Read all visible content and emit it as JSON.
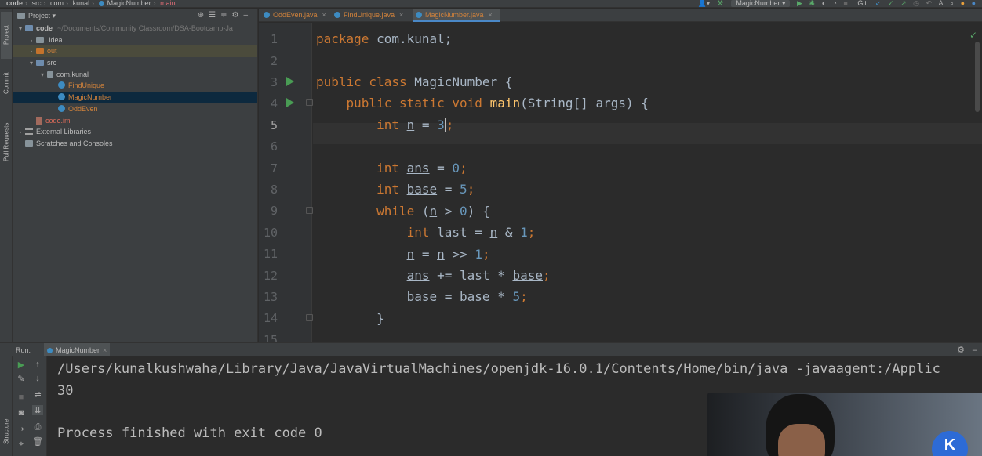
{
  "breadcrumbs": [
    "code",
    "src",
    "com",
    "kunal",
    "MagicNumber",
    "main"
  ],
  "toolbar": {
    "run_config": "MagicNumber",
    "git_label": "Git:"
  },
  "left_strip": {
    "tabs": [
      "Project",
      "Commit",
      "Pull Requests"
    ]
  },
  "project_panel": {
    "title": "Project",
    "tree": [
      {
        "label": "code",
        "detail": "~/Documents/Community Classroom/DSA-Bootcamp-Ja",
        "kind": "module"
      },
      {
        "label": ".idea",
        "kind": "folder"
      },
      {
        "label": "out",
        "kind": "out-folder"
      },
      {
        "label": "src",
        "kind": "src-folder"
      },
      {
        "label": "com.kunal",
        "kind": "package"
      },
      {
        "label": "FindUnique",
        "kind": "class"
      },
      {
        "label": "MagicNumber",
        "kind": "class",
        "selected": true
      },
      {
        "label": "OddEven",
        "kind": "class"
      },
      {
        "label": "code.iml",
        "kind": "iml"
      },
      {
        "label": "External Libraries",
        "kind": "libraries"
      },
      {
        "label": "Scratches and Consoles",
        "kind": "scratches"
      }
    ]
  },
  "editor": {
    "tabs": [
      {
        "label": "OddEven.java"
      },
      {
        "label": "FindUnique.java"
      },
      {
        "label": "MagicNumber.java",
        "active": true
      }
    ],
    "line_numbers": [
      "1",
      "2",
      "3",
      "4",
      "5",
      "6",
      "7",
      "8",
      "9",
      "10",
      "11",
      "12",
      "13",
      "14",
      "15"
    ],
    "current_line": "5",
    "code": {
      "l1_package": "package",
      "l1_name": " com.kunal;",
      "l3_public": "public",
      "l3_class": " class",
      "l3_name": " MagicNumber {",
      "l4_public": "public",
      "l4_static": " static",
      "l4_void": " void",
      "l4_main": "main",
      "l4_rest": "(String[] args) {",
      "int_kw": "int",
      "var_n": "n",
      "var_ans": "ans",
      "var_base": "base",
      "var_last": "last",
      "op_eq": " = ",
      "val_3": "3",
      "val_0": "0",
      "val_5": "5",
      "val_1": "1",
      "semicolon": ";",
      "while_kw": "while",
      "while_open": " (",
      "while_cmp": " > ",
      "while_close": ") {",
      "op_and": " & ",
      "op_shift": " >> ",
      "op_pluseq": " += ",
      "op_mul": " * ",
      "close_brace": "}"
    }
  },
  "run_panel": {
    "label": "Run:",
    "tab": "MagicNumber",
    "bottom_strip": [
      "Structure"
    ],
    "console": [
      "/Users/kunalkushwaha/Library/Java/JavaVirtualMachines/openjdk-16.0.1/Contents/Home/bin/java -javaagent:/Applic",
      "30",
      "",
      "Process finished with exit code 0"
    ]
  },
  "colors": {
    "keyword": "#cc7832",
    "number": "#6897bb",
    "method": "#ffc66d",
    "plain": "#a9b7c6",
    "selection": "#0d293e",
    "run_green": "#499c54"
  },
  "icons": [
    "project-folder-icon",
    "chevron-down-icon",
    "target-icon",
    "collapse-icon",
    "gear-icon",
    "minimize-icon",
    "run-icon",
    "debug-icon",
    "git-update-icon",
    "git-commit-icon",
    "git-push-icon",
    "search-icon",
    "wrench-icon",
    "rerun-icon",
    "stop-icon",
    "up-arrow-icon",
    "down-arrow-icon",
    "soft-wrap-icon",
    "print-icon",
    "trash-icon"
  ]
}
